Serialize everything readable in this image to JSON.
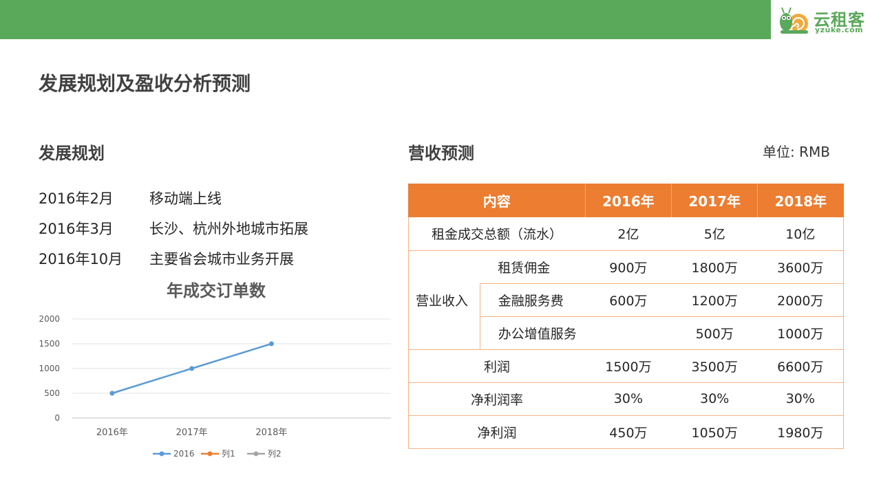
{
  "brand": {
    "name": "云租客",
    "domain": "yzuke.com",
    "color": "#5aa85a"
  },
  "page_title": "发展规划及盈收分析预测",
  "development": {
    "title": "发展规划",
    "items": [
      {
        "date": "2016年2月",
        "text": "移动端上线"
      },
      {
        "date": "2016年3月",
        "text": "长沙、杭州外地城市拓展"
      },
      {
        "date": "2016年10月",
        "text": "主要省会城市业务开展"
      }
    ]
  },
  "revenue": {
    "title": "营收预测",
    "unit": "单位: RMB",
    "header": [
      "内容",
      "2016年",
      "2017年",
      "2018年"
    ],
    "rows": {
      "total": {
        "label": "租金成交总额（流水）",
        "values": [
          "2亿",
          "5亿",
          "10亿"
        ]
      },
      "income_group": "营业收入",
      "income": [
        {
          "label": "租赁佣金",
          "values": [
            "900万",
            "1800万",
            "3600万"
          ]
        },
        {
          "label": "金融服务费",
          "values": [
            "600万",
            "1200万",
            "2000万"
          ]
        },
        {
          "label": "办公增值服务",
          "values": [
            "",
            "500万",
            "1000万"
          ]
        }
      ],
      "profit": {
        "label": "利润",
        "values": [
          "1500万",
          "3500万",
          "6600万"
        ]
      },
      "margin": {
        "label": "净利润率",
        "values": [
          "30%",
          "30%",
          "30%"
        ]
      },
      "net": {
        "label": "净利润",
        "values": [
          "450万",
          "1050万",
          "1980万"
        ]
      }
    },
    "accent_color": "#ed7d31"
  },
  "chart_data": {
    "type": "line",
    "title": "年成交订单数",
    "categories": [
      "2016年",
      "2017年",
      "2018年"
    ],
    "series": [
      {
        "name": "2016",
        "values": [
          500,
          1000,
          1500
        ],
        "color": "#5b9bd5"
      },
      {
        "name": "列1",
        "values": [],
        "color": "#ed7d31"
      },
      {
        "name": "列2",
        "values": [],
        "color": "#a5a5a5"
      }
    ],
    "ylim": [
      0,
      2000
    ],
    "yticks": [
      0,
      500,
      1000,
      1500,
      2000
    ],
    "grid": true,
    "legend": "bottom"
  }
}
